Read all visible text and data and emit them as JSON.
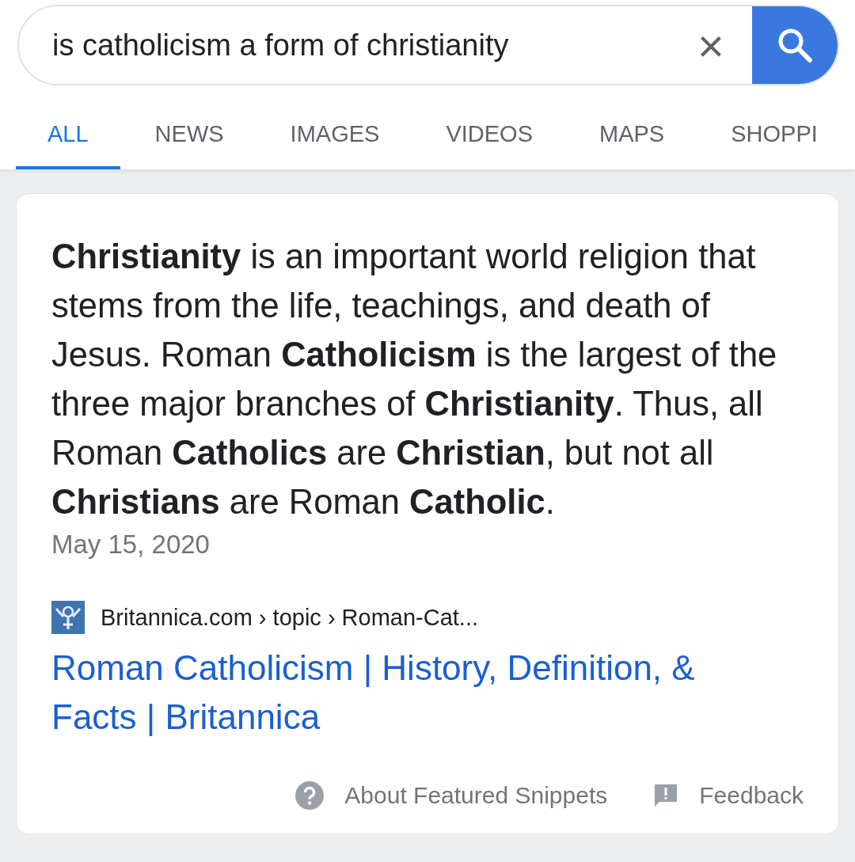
{
  "search": {
    "value": "is catholicism a form of christianity",
    "clear": "×"
  },
  "tabs": [
    {
      "label": "ALL",
      "selected": true
    },
    {
      "label": "NEWS",
      "selected": false
    },
    {
      "label": "IMAGES",
      "selected": false
    },
    {
      "label": "VIDEOS",
      "selected": false
    },
    {
      "label": "MAPS",
      "selected": false
    },
    {
      "label": "SHOPPI",
      "selected": false
    }
  ],
  "snippet": {
    "text": "**Christianity** is an important world religion that stems from the life, teachings, and death of Jesus. Roman **Catholicism** is the largest of the three major branches of **Christianity**. Thus, all Roman **Catholics** are **Christian**, but not all **Christians** are Roman **Catholic**.",
    "date": "May 15, 2020",
    "breadcrumb": "Britannica.com › topic › Roman-Cat...",
    "title": "Roman Catholicism | History, Definition, & Facts | Britannica"
  },
  "footer": [
    {
      "kind": "help",
      "label": "About Featured Snippets"
    },
    {
      "kind": "feedback",
      "label": "Feedback"
    }
  ]
}
